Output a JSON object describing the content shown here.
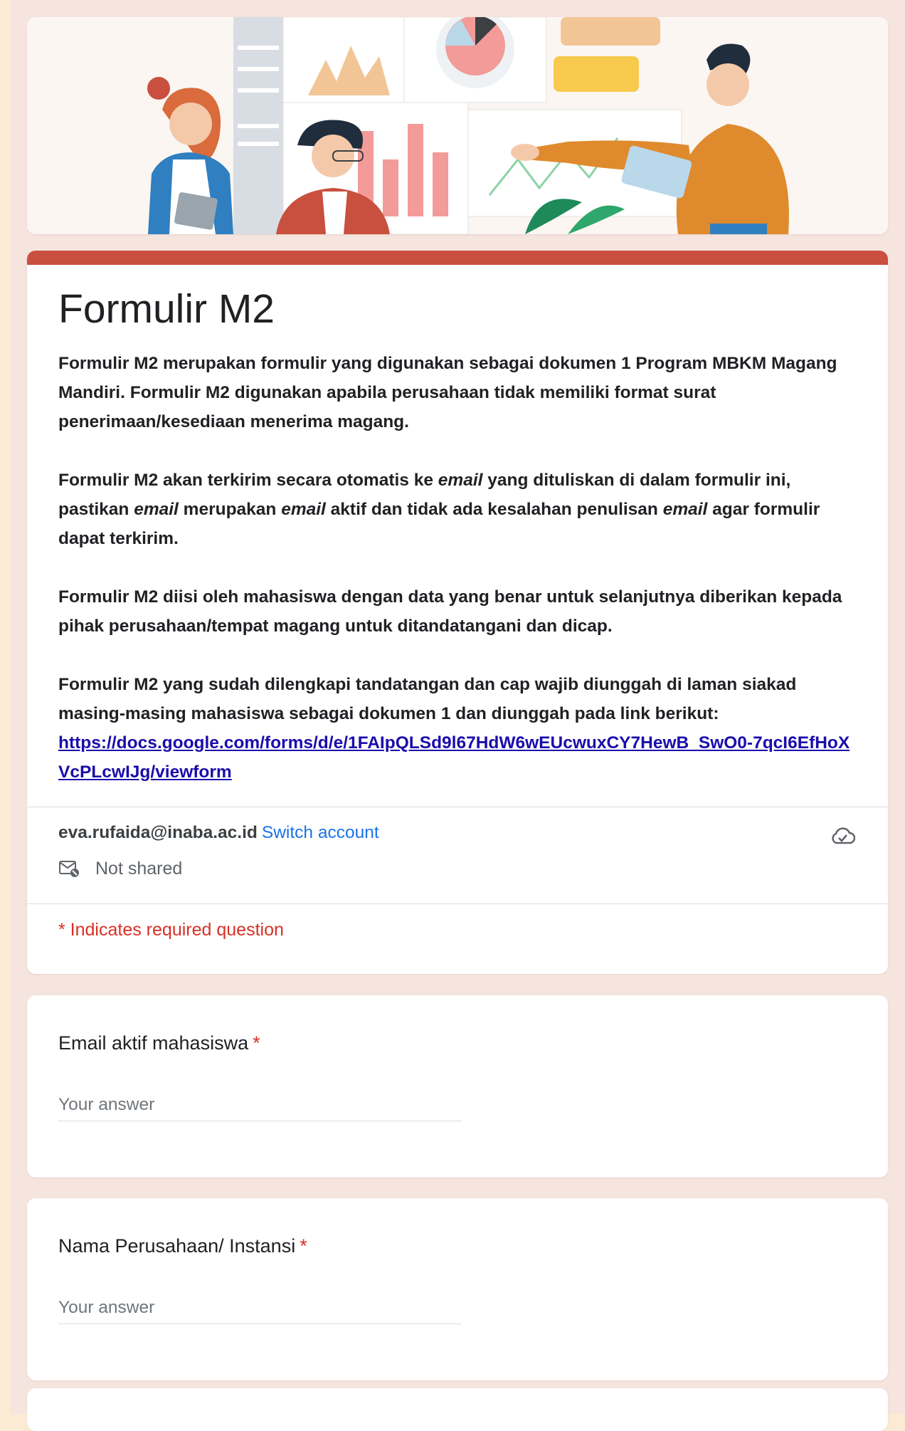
{
  "form": {
    "title": "Formulir M2",
    "accent_color": "#c94f3e",
    "description": {
      "p1": "Formulir M2 merupakan formulir yang digunakan sebagai dokumen 1 Program MBKM Magang Mandiri. Formulir M2 digunakan apabila perusahaan tidak memiliki format surat penerimaan/kesediaan menerima magang.",
      "p2_a": "Formulir M2 akan terkirim secara otomatis ke ",
      "p2_em1": "email",
      "p2_b": " yang dituliskan di dalam formulir ini, pastikan ",
      "p2_em2": "email",
      "p2_c": " merupakan ",
      "p2_em3": "email",
      "p2_d": " aktif dan tidak ada kesalahan penulisan ",
      "p2_em4": "email",
      "p2_e": " agar formulir dapat terkirim.",
      "p3": "Formulir M2 diisi oleh mahasiswa dengan data yang benar untuk selanjutnya diberikan kepada pihak perusahaan/tempat magang untuk ditandatangani dan dicap.",
      "p4": "Formulir M2 yang sudah dilengkapi tandatangan dan cap wajib diunggah di laman siakad masing-masing mahasiswa sebagai dokumen 1 dan diunggah pada link berikut:",
      "link": "https://docs.google.com/forms/d/e/1FAIpQLSd9l67HdW6wEUcwuxCY7HewB_SwO0-7qcI6EfHoXVcPLcwIJg/viewform"
    }
  },
  "account": {
    "email": "eva.rufaida@inaba.ac.id",
    "switch_label": "Switch account",
    "shared_status": "Not shared",
    "icons": {
      "shared": "mail-not-shared-icon",
      "save": "cloud-save-icon"
    }
  },
  "required_note": "* Indicates required question",
  "questions": [
    {
      "label": "Email aktif mahasiswa",
      "required_mark": "*",
      "placeholder": "Your answer"
    },
    {
      "label": "Nama Perusahaan/ Instansi",
      "required_mark": "*",
      "placeholder": "Your answer"
    }
  ]
}
